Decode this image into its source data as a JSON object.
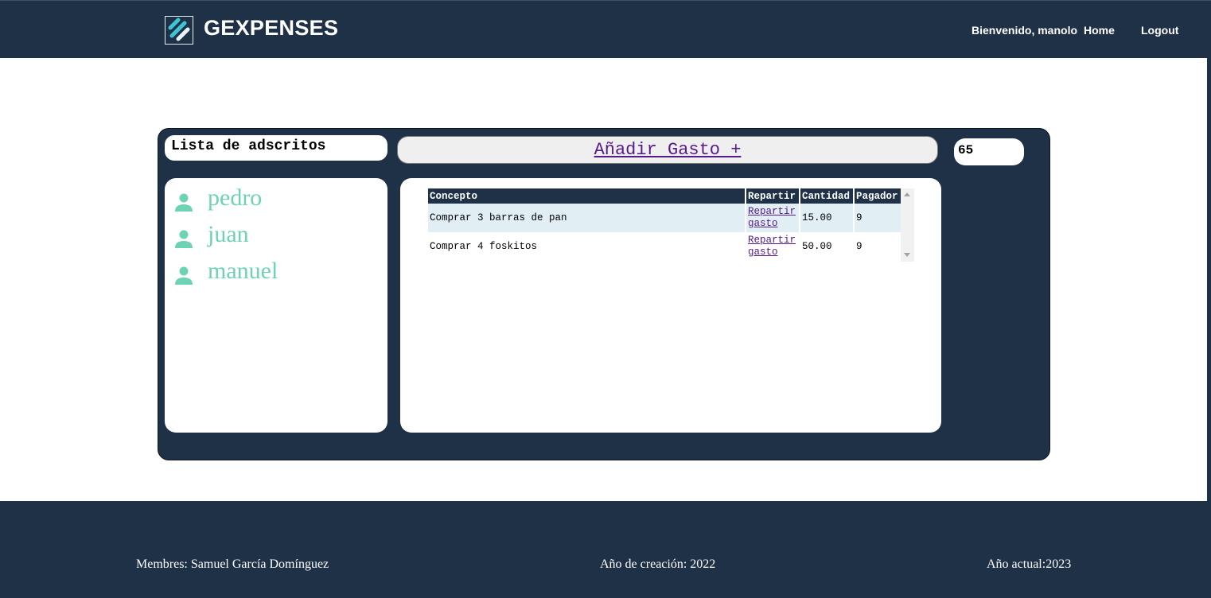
{
  "header": {
    "brand": "GEXPENSES",
    "logo_icon": "stripes-logo-icon",
    "welcome": "Bienvenido, manolo",
    "nav": {
      "home": "Home",
      "logout": "Logout"
    }
  },
  "sidebar": {
    "title": "Lista de adscritos",
    "members": [
      {
        "name": "pedro",
        "icon": "person-icon"
      },
      {
        "name": "juan",
        "icon": "person-icon"
      },
      {
        "name": "manuel",
        "icon": "person-icon"
      }
    ]
  },
  "actions": {
    "add_expense": "Añadir Gasto +"
  },
  "total": "65",
  "table": {
    "headers": [
      "Concepto",
      "Repartir",
      "Cantidad",
      "Pagador"
    ],
    "rows": [
      {
        "concepto": "Comprar 3 barras de pan",
        "repartir": "Repartir gasto",
        "cantidad": "15.00",
        "pagador": "9"
      },
      {
        "concepto": "Comprar 4 foskitos",
        "repartir": "Repartir gasto",
        "cantidad": "50.00",
        "pagador": "9"
      }
    ]
  },
  "footer": {
    "members": "Membres: Samuel García Domínguez",
    "creation": "Año de creación: 2022",
    "actual": "Año actual:2023"
  },
  "colors": {
    "navy": "#1e3147",
    "member_green": "#6ed3b4",
    "link_purple": "#551a8b",
    "row_alt": "#e1eef4",
    "logo_cyan": "#3fc4d6"
  }
}
